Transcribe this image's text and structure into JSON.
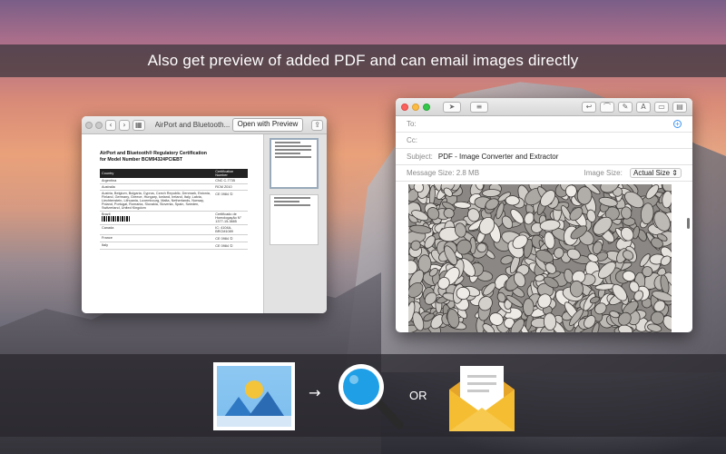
{
  "banner": {
    "text": "Also get preview of added PDF and can email images directly"
  },
  "preview_window": {
    "title": "AirPort and Bluetooth...",
    "open_button": "Open with Preview",
    "nav_back": "‹",
    "nav_forward": "›",
    "share_icon": "⇪",
    "doc": {
      "logo": "",
      "title_line1": "AirPort and Bluetooth® Regulatory Certification",
      "title_line2": "for Model Number BCM94324PCIEBT",
      "table_headers": [
        "Country",
        "Certification Number"
      ],
      "rows": [
        [
          "Argentina",
          "CNC C-7735"
        ],
        [
          "Australia",
          "RCM Z010"
        ],
        [
          "Austria, Belgium, Bulgaria, Cyprus, Czech Republic, Denmark, Estonia, Finland, Germany, Greece, Hungary, Iceland, Ireland, Italy, Latvia, Liechtenstein, Lithuania, Luxembourg, Malta, Netherlands, Norway, Poland, Portugal, Romania, Slovakia, Slovenia, Spain, Sweden, Switzerland, United Kingdom",
          "CE 0984 ①"
        ],
        [
          "Brazil",
          "Certificado de Homologação N° 1377-15-3885"
        ],
        [
          "Canada",
          "IC: 4104A-BRCM1089"
        ],
        [
          "France",
          "CE 0984 ①"
        ],
        [
          "Italy",
          "CE 0984 ①"
        ]
      ]
    }
  },
  "mail_window": {
    "to_label": "To:",
    "cc_label": "Cc:",
    "subject_label": "Subject:",
    "subject_value": "PDF - Image Converter and Extractor",
    "message_size_label": "Message Size:",
    "message_size_value": "2.8 MB",
    "image_size_label": "Image Size:",
    "image_size_value": "Actual Size",
    "font_button": "A"
  },
  "bottom": {
    "or_text": "OR",
    "arrow": "→"
  },
  "colors": {
    "accent_blue": "#3b93f5",
    "envelope_yellow": "#f5bd32",
    "lens_blue": "#1e9fe6"
  }
}
